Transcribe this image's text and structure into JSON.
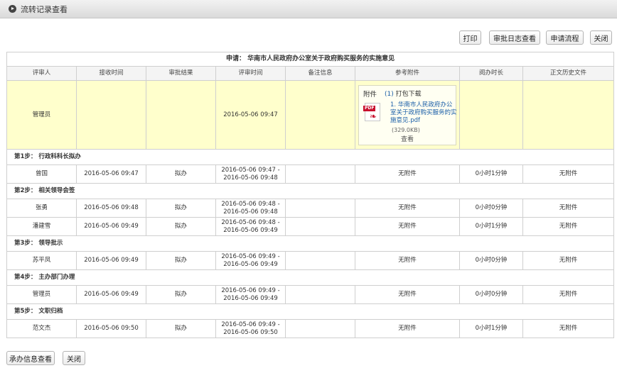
{
  "window": {
    "title": "流转记录查看"
  },
  "toolbar": {
    "print": "打印",
    "log_view": "审批日志查看",
    "flow": "申请流程",
    "close": "关闭"
  },
  "table": {
    "title_prefix": "申请：",
    "title": "华南市人民政府办公室关于政府购买服务的实施意见",
    "columns": [
      "评审人",
      "接收时间",
      "审批结果",
      "评审时间",
      "备注信息",
      "参考附件",
      "阅办时长",
      "正文历史文件"
    ],
    "current": {
      "reviewer": "管理员",
      "review_time": "2016-05-06 09:47",
      "attachment": {
        "label": "附件",
        "download_num": "(1)",
        "download_label": "打包下载",
        "file_index": "1.",
        "file_name": "华南市人民政府办公室关于政府购买服务的实施意见.pdf",
        "file_size": "(329.0KB)",
        "view": "查看"
      }
    },
    "steps": [
      {
        "label": "第1步： 行政科科长拟办",
        "rows": [
          {
            "reviewer": "曾国",
            "received": "2016-05-06 09:47",
            "result": "拟办",
            "review_start": "2016-05-06 09:47 -",
            "review_end": "2016-05-06 09:48",
            "note": "",
            "attachment": "无附件",
            "duration": "0小时1分钟",
            "history": "无附件"
          }
        ]
      },
      {
        "label": "第2步： 相关领导会签",
        "rows": [
          {
            "reviewer": "张勇",
            "received": "2016-05-06 09:48",
            "result": "拟办",
            "review_start": "2016-05-06 09:48 -",
            "review_end": "2016-05-06 09:48",
            "note": "",
            "attachment": "无附件",
            "duration": "0小时0分钟",
            "history": "无附件"
          },
          {
            "reviewer": "潘建雪",
            "received": "2016-05-06 09:49",
            "result": "拟办",
            "review_start": "2016-05-06 09:48 -",
            "review_end": "2016-05-06 09:49",
            "note": "",
            "attachment": "无附件",
            "duration": "0小时1分钟",
            "history": "无附件"
          }
        ]
      },
      {
        "label": "第3步： 领导批示",
        "rows": [
          {
            "reviewer": "苏平凤",
            "received": "2016-05-06 09:49",
            "result": "拟办",
            "review_start": "2016-05-06 09:49 -",
            "review_end": "2016-05-06 09:49",
            "note": "",
            "attachment": "无附件",
            "duration": "0小时0分钟",
            "history": "无附件"
          }
        ]
      },
      {
        "label": "第4步： 主办部门办理",
        "rows": [
          {
            "reviewer": "管理员",
            "received": "2016-05-06 09:49",
            "result": "拟办",
            "review_start": "2016-05-06 09:49 -",
            "review_end": "2016-05-06 09:49",
            "note": "",
            "attachment": "无附件",
            "duration": "0小时0分钟",
            "history": "无附件"
          }
        ]
      },
      {
        "label": "第5步： 文职归档",
        "rows": [
          {
            "reviewer": "范文杰",
            "received": "2016-05-06 09:50",
            "result": "拟办",
            "review_start": "2016-05-06 09:49 -",
            "review_end": "2016-05-06 09:50",
            "note": "",
            "attachment": "无附件",
            "duration": "0小时1分钟",
            "history": "无附件"
          }
        ]
      }
    ]
  },
  "footer": {
    "info_view": "承办信息查看",
    "close": "关闭"
  }
}
